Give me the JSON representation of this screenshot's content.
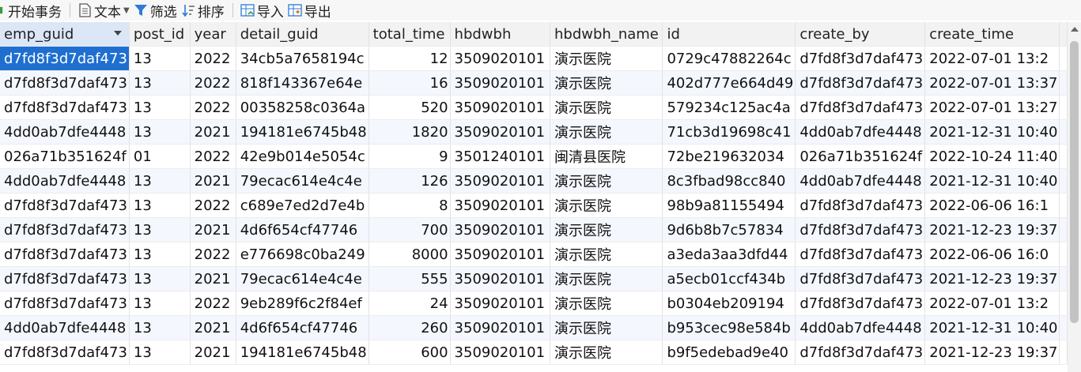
{
  "toolbar": {
    "begin_transaction": "开始事务",
    "text": "文本",
    "filter": "筛选",
    "sort": "排序",
    "import": "导入",
    "export": "导出"
  },
  "colors": {
    "selection": "#1f6fd0",
    "header": "#f2f2f2",
    "alt_row": "#f4f7fd"
  },
  "grid": {
    "columns": [
      "emp_guid",
      "post_id",
      "year",
      "detail_guid",
      "total_time",
      "hbdwbh",
      "hbdwbh_name",
      "id",
      "create_by",
      "create_time",
      ""
    ],
    "rows": [
      [
        "d7fd8f3d7daf473",
        "13",
        "2022",
        "34cb5a7658194c",
        "12",
        "3509020101",
        "演示医院",
        "0729c47882264c",
        "d7fd8f3d7daf473",
        "2022-07-01 13:2",
        ""
      ],
      [
        "d7fd8f3d7daf473",
        "13",
        "2022",
        "818f143367e64e",
        "16",
        "3509020101",
        "演示医院",
        "402d777e664d49",
        "d7fd8f3d7daf473",
        "2022-07-01 13:37",
        ""
      ],
      [
        "d7fd8f3d7daf473",
        "13",
        "2022",
        "00358258c0364a",
        "520",
        "3509020101",
        "演示医院",
        "579234c125ac4a",
        "d7fd8f3d7daf473",
        "2022-07-01 13:27",
        ""
      ],
      [
        "4dd0ab7dfe4448",
        "13",
        "2021",
        "194181e6745b48",
        "1820",
        "3509020101",
        "演示医院",
        "71cb3d19698c41",
        "4dd0ab7dfe4448",
        "2021-12-31 10:40",
        ""
      ],
      [
        "026a71b351624f",
        "01",
        "2022",
        "42e9b014e5054c",
        "9",
        "3501240101",
        "闽清县医院",
        "72be219632034",
        "026a71b351624f",
        "2022-10-24 11:40",
        ""
      ],
      [
        "4dd0ab7dfe4448",
        "13",
        "2021",
        "79ecac614e4c4e",
        "126",
        "3509020101",
        "演示医院",
        "8c3fbad98cc840",
        "4dd0ab7dfe4448",
        "2021-12-31 10:40",
        ""
      ],
      [
        "d7fd8f3d7daf473",
        "13",
        "2022",
        "c689e7ed2d7e4b",
        "8",
        "3509020101",
        "演示医院",
        "98b9a81155494",
        "d7fd8f3d7daf473",
        "2022-06-06 16:1",
        ""
      ],
      [
        "d7fd8f3d7daf473",
        "13",
        "2021",
        "4d6f654cf47746",
        "700",
        "3509020101",
        "演示医院",
        "9d6b8b7c57834",
        "d7fd8f3d7daf473",
        "2021-12-23 19:37",
        ""
      ],
      [
        "d7fd8f3d7daf473",
        "13",
        "2022",
        "e776698c0ba249",
        "8000",
        "3509020101",
        "演示医院",
        "a3eda3aa3dfd44",
        "d7fd8f3d7daf473",
        "2022-06-06 16:0",
        ""
      ],
      [
        "d7fd8f3d7daf473",
        "13",
        "2021",
        "79ecac614e4c4e",
        "555",
        "3509020101",
        "演示医院",
        "a5ecb01ccf434b",
        "d7fd8f3d7daf473",
        "2021-12-23 19:37",
        ""
      ],
      [
        "d7fd8f3d7daf473",
        "13",
        "2022",
        "9eb289f6c2f84ef",
        "24",
        "3509020101",
        "演示医院",
        "b0304eb209194",
        "d7fd8f3d7daf473",
        "2022-07-01 13:2",
        ""
      ],
      [
        "4dd0ab7dfe4448",
        "13",
        "2021",
        "4d6f654cf47746",
        "260",
        "3509020101",
        "演示医院",
        "b953cec98e584b",
        "4dd0ab7dfe4448",
        "2021-12-31 10:40",
        ""
      ],
      [
        "d7fd8f3d7daf473",
        "13",
        "2021",
        "194181e6745b48",
        "600",
        "3509020101",
        "演示医院",
        "b9f5edebad9e40",
        "d7fd8f3d7daf473",
        "2021-12-23 19:37",
        ""
      ]
    ]
  }
}
